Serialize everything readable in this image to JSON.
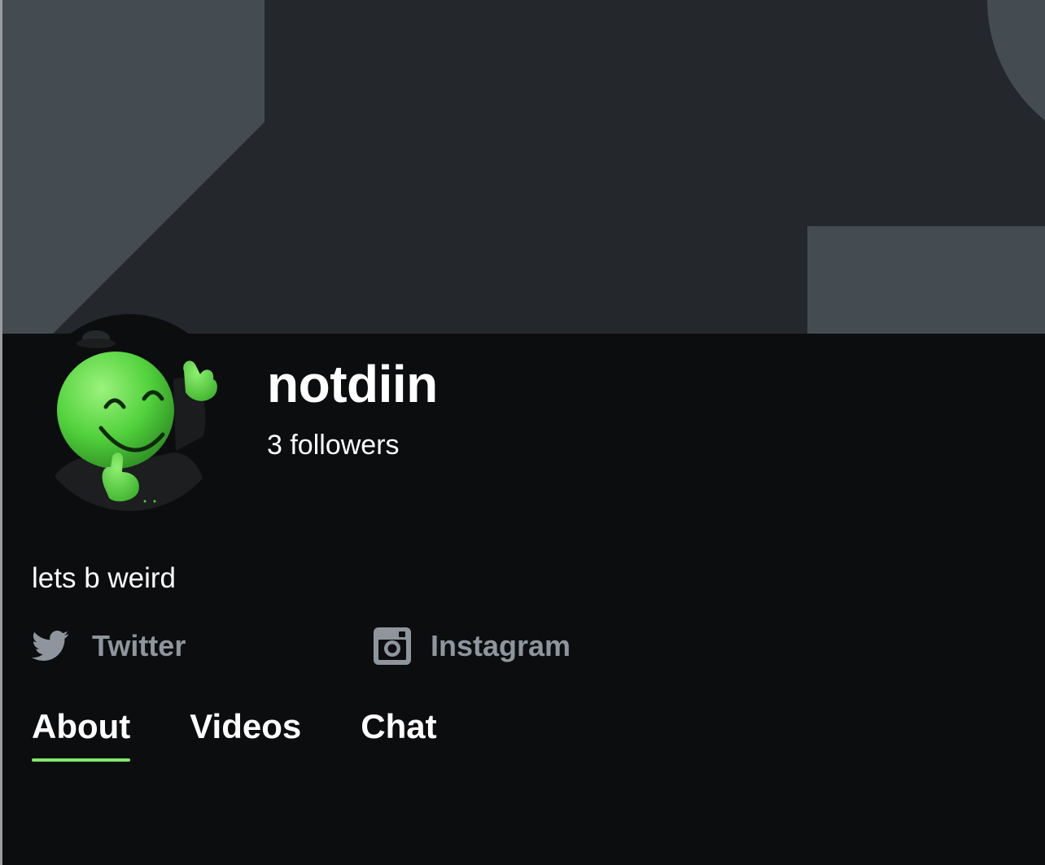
{
  "theme": {
    "background": "#0c0d0f",
    "banner_background": "#24272c",
    "banner_shapes": "#444c52",
    "accent": "#7fe86a",
    "muted_text": "#8f959c"
  },
  "profile": {
    "username": "notdiin",
    "followers": "3 followers",
    "bio": "lets b weird",
    "avatar_icon": "green-smiley-mascot-icon"
  },
  "social_links": [
    {
      "name": "Twitter",
      "icon": "twitter-bird-icon"
    },
    {
      "name": "Instagram",
      "icon": "instagram-icon"
    }
  ],
  "tabs": [
    {
      "label": "About",
      "active": true
    },
    {
      "label": "Videos",
      "active": false
    },
    {
      "label": "Chat",
      "active": false
    }
  ]
}
